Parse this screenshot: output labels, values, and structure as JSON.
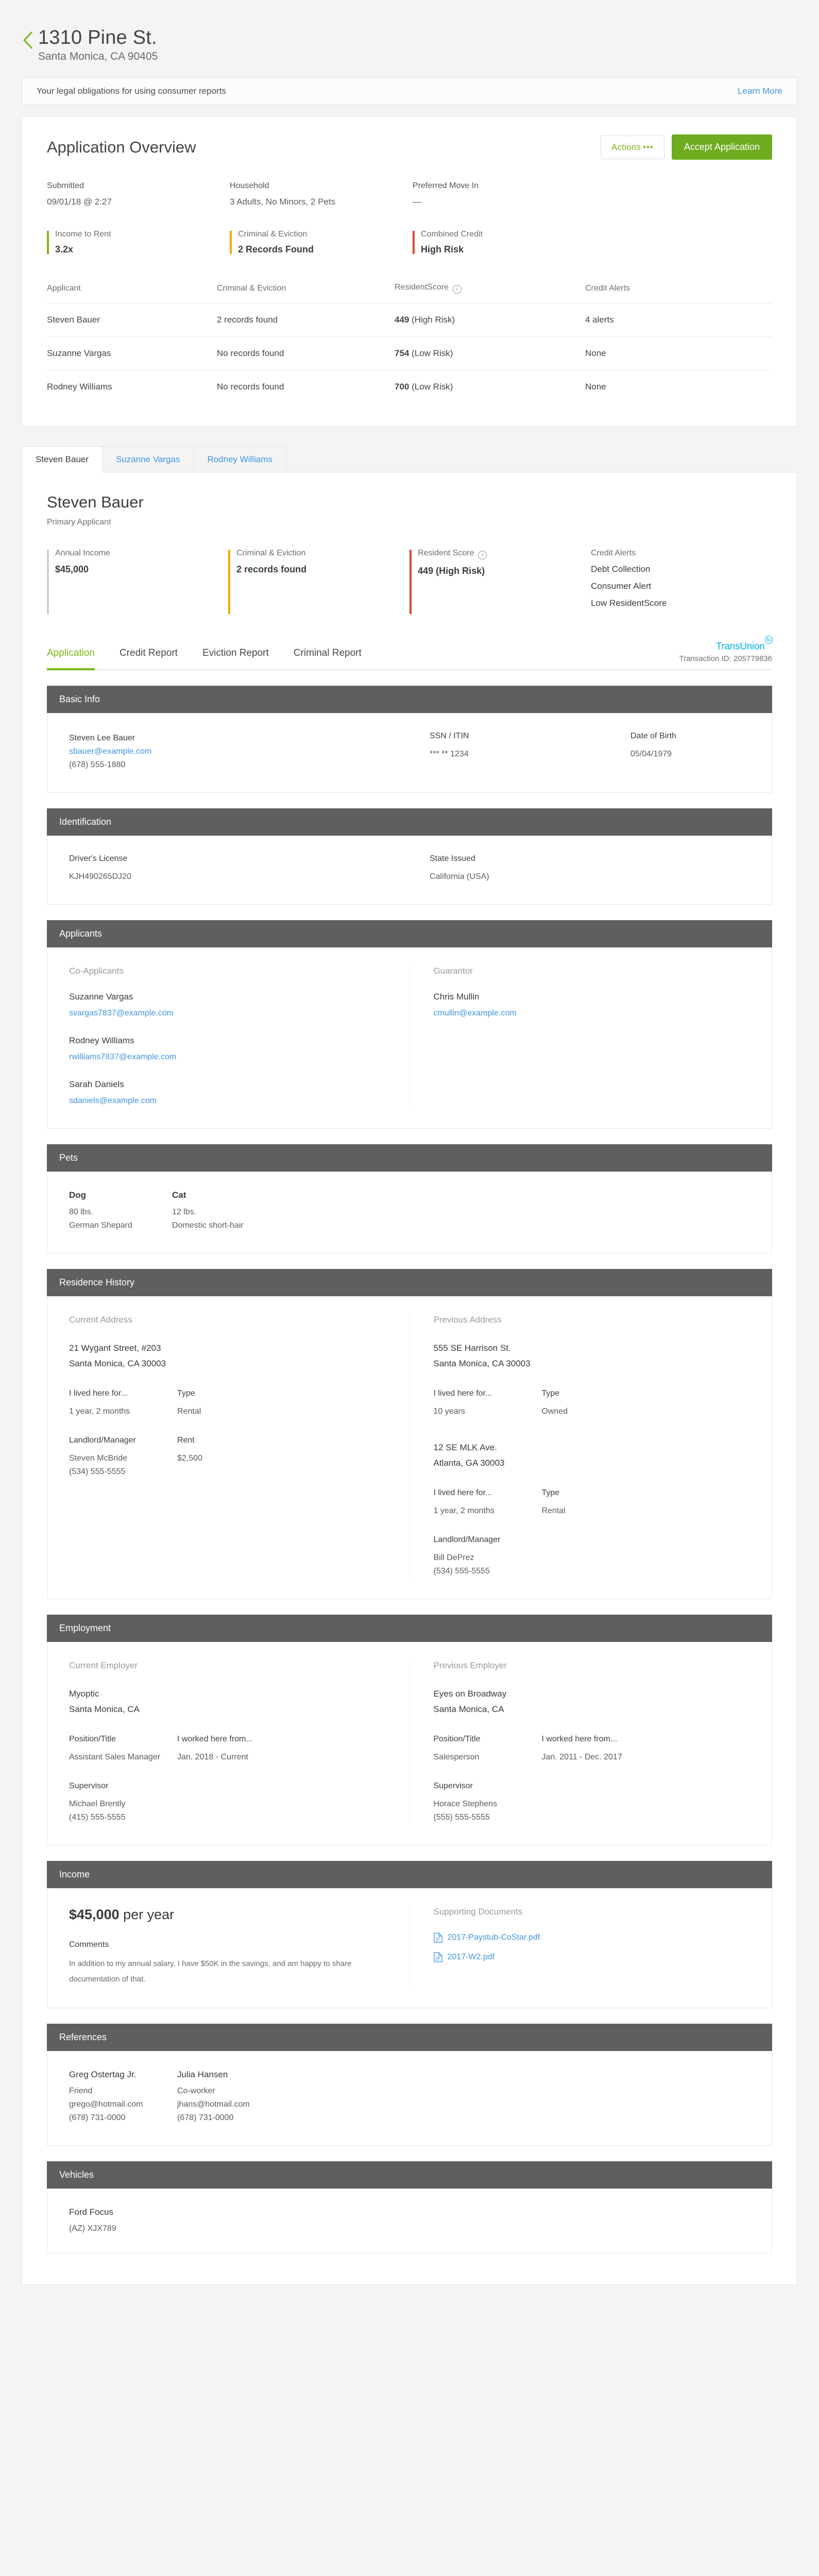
{
  "header": {
    "back_icon": "chevron-left-icon",
    "address_line1": "1310 Pine St.",
    "address_line2": "Santa Monica, CA 90405"
  },
  "legal_bar": {
    "text": "Your legal obligations for using consumer reports",
    "link": "Learn More"
  },
  "overview": {
    "title": "Application Overview",
    "actions_label": "Actions",
    "actions_dots": "•••",
    "accept_label": "Accept Application",
    "meta": [
      {
        "label": "Submitted",
        "value": "09/01/18 @ 2:27"
      },
      {
        "label": "Household",
        "value": "3 Adults, No Minors, 2 Pets"
      },
      {
        "label": "Preferred Move In",
        "value": "—"
      }
    ],
    "stats": [
      {
        "label": "Income to Rent",
        "value": "3.2x",
        "color": "#7cb518"
      },
      {
        "label": "Criminal & Eviction",
        "value": "2 Records Found",
        "color": "#f2a900"
      },
      {
        "label": "Combined Credit",
        "value": "High Risk",
        "color": "#e0452f"
      }
    ],
    "table": {
      "columns": [
        "Applicant",
        "Criminal & Eviction",
        "ResidentScore",
        "Credit Alerts"
      ],
      "score_info_icon": "info-icon",
      "rows": [
        {
          "applicant": "Steven Bauer",
          "criminal": "2 records found",
          "score": "449",
          "score_risk": " (High Risk)",
          "alerts": "4 alerts"
        },
        {
          "applicant": "Suzanne Vargas",
          "criminal": "No records found",
          "score": "754",
          "score_risk": " (Low Risk)",
          "alerts": "None"
        },
        {
          "applicant": "Rodney Williams",
          "criminal": "No records found",
          "score": "700",
          "score_risk": " (Low Risk)",
          "alerts": "None"
        }
      ]
    }
  },
  "applicant_tabs": [
    {
      "label": "Steven Bauer",
      "active": true
    },
    {
      "label": "Suzanne Vargas",
      "active": false
    },
    {
      "label": "Rodney Williams",
      "active": false
    }
  ],
  "applicant": {
    "name": "Steven Bauer",
    "role": "Primary Applicant",
    "stats": [
      {
        "label": "Annual Income",
        "value": "$45,000",
        "color": "#cfcfcf"
      },
      {
        "label": "Criminal & Eviction",
        "value": "2 records found",
        "color": "#f2a900"
      },
      {
        "label": "Resident Score",
        "value": "449 (High Risk)",
        "color": "#e0452f",
        "info_icon": "info-icon"
      }
    ],
    "credit_alerts_label": "Credit Alerts",
    "credit_alerts": [
      "Debt Collection",
      "Consumer Alert",
      "Low ResidentScore"
    ]
  },
  "report_tabs": [
    {
      "label": "Application",
      "active": true
    },
    {
      "label": "Credit Report",
      "active": false
    },
    {
      "label": "Eviction Report",
      "active": false
    },
    {
      "label": "Criminal Report",
      "active": false
    }
  ],
  "transunion": {
    "logo": "TransUnion",
    "logo_mark": "tu",
    "transaction_id": "Transaction ID: 205779836"
  },
  "sections": {
    "basic_info": {
      "title": "Basic Info",
      "full_name": "Steven Lee Bauer",
      "email": "sbauer@example.com",
      "phone": "(678) 555-1880",
      "ssn_label": "SSN / ITIN",
      "ssn_value": "*** ** 1234",
      "dob_label": "Date of Birth",
      "dob_value": "05/04/1979"
    },
    "identification": {
      "title": "Identification",
      "license_label": "Driver's License",
      "license_value": "KJH490265DJ20",
      "state_label": "State Issued",
      "state_value": "California (USA)"
    },
    "applicants": {
      "title": "Applicants",
      "co_applicants_label": "Co-Applicants",
      "guarantor_label": "Guarantor",
      "co_applicants": [
        {
          "name": "Suzanne Vargas",
          "email": "svargas7837@example.com"
        },
        {
          "name": "Rodney Williams",
          "email": "rwilliams7837@example.com"
        },
        {
          "name": "Sarah Daniels",
          "email": "sdaniels@example.com"
        }
      ],
      "guarantors": [
        {
          "name": "Chris Mullin",
          "email": "cmullin@example.com"
        }
      ]
    },
    "pets": {
      "title": "Pets",
      "items": [
        {
          "type": "Dog",
          "weight": "80 lbs.",
          "breed": "German Shepard"
        },
        {
          "type": "Cat",
          "weight": "12 lbs.",
          "breed": "Domestic short-hair"
        }
      ]
    },
    "residence": {
      "title": "Residence History",
      "current_label": "Current Address",
      "previous_label": "Previous Address",
      "current": {
        "line1": "21 Wygant Street, #203",
        "line2": "Santa Monica, CA 30003",
        "lived_label": "I lived here for...",
        "lived_value": "1 year, 2 months",
        "type_label": "Type",
        "type_value": "Rental",
        "landlord_label": "Landlord/Manager",
        "landlord_name": "Steven McBride",
        "landlord_phone": "(534) 555-5555",
        "rent_label": "Rent",
        "rent_value": "$2,500"
      },
      "previous": [
        {
          "line1": "555 SE Harrison St.",
          "line2": "Santa Monica, CA 30003",
          "lived_label": "I lived here for...",
          "lived_value": "10 years",
          "type_label": "Type",
          "type_value": "Owned"
        },
        {
          "line1": "12 SE MLK Ave.",
          "line2": "Atlanta, GA 30003",
          "lived_label": "I lived here for...",
          "lived_value": "1 year, 2 months",
          "type_label": "Type",
          "type_value": "Rental",
          "landlord_label": "Landlord/Manager",
          "landlord_name": "Bill DePrez",
          "landlord_phone": "(534) 555-5555"
        }
      ]
    },
    "employment": {
      "title": "Employment",
      "current_label": "Current Employer",
      "previous_label": "Previous Employer",
      "current": {
        "company": "Myoptic",
        "location": "Santa Monica, CA",
        "position_label": "Position/Title",
        "position_value": "Assistant Sales Manager",
        "worked_label": "I worked here from...",
        "worked_value": "Jan. 2018 - Current",
        "supervisor_label": "Supervisor",
        "supervisor_name": "Michael Brently",
        "supervisor_phone": "(415) 555-5555"
      },
      "previous": {
        "company": "Eyes on Broadway",
        "location": "Santa Monica, CA",
        "position_label": "Position/Title",
        "position_value": "Salesperson",
        "worked_label": "I worked here from...",
        "worked_value": "Jan. 2011 - Dec. 2017",
        "supervisor_label": "Supervisor",
        "supervisor_name": "Horace Stephens",
        "supervisor_phone": "(555) 555-5555"
      }
    },
    "income": {
      "title": "Income",
      "amount": "$45,000",
      "period": " per year",
      "comments_label": "Comments",
      "comments_text": "In addition to my annual salary, I have $50K in the savings, and am happy to share documentation of that.",
      "docs_label": "Supporting Documents",
      "docs": [
        {
          "name": "2017-Paystub-CoStar.pdf",
          "icon": "document-icon"
        },
        {
          "name": "2017-W2.pdf",
          "icon": "document-icon"
        }
      ]
    },
    "references": {
      "title": "References",
      "items": [
        {
          "name": "Greg Ostertag Jr.",
          "relation": "Friend",
          "email": "grego@hotmail.com",
          "phone": "(678) 731-0000"
        },
        {
          "name": "Julia Hansen",
          "relation": "Co-worker",
          "email": "jhans@hotmail.com",
          "phone": "(678) 731-0000"
        }
      ]
    },
    "vehicles": {
      "title": "Vehicles",
      "items": [
        {
          "model": "Ford Focus",
          "plate": "(AZ) XJX789"
        }
      ]
    }
  }
}
